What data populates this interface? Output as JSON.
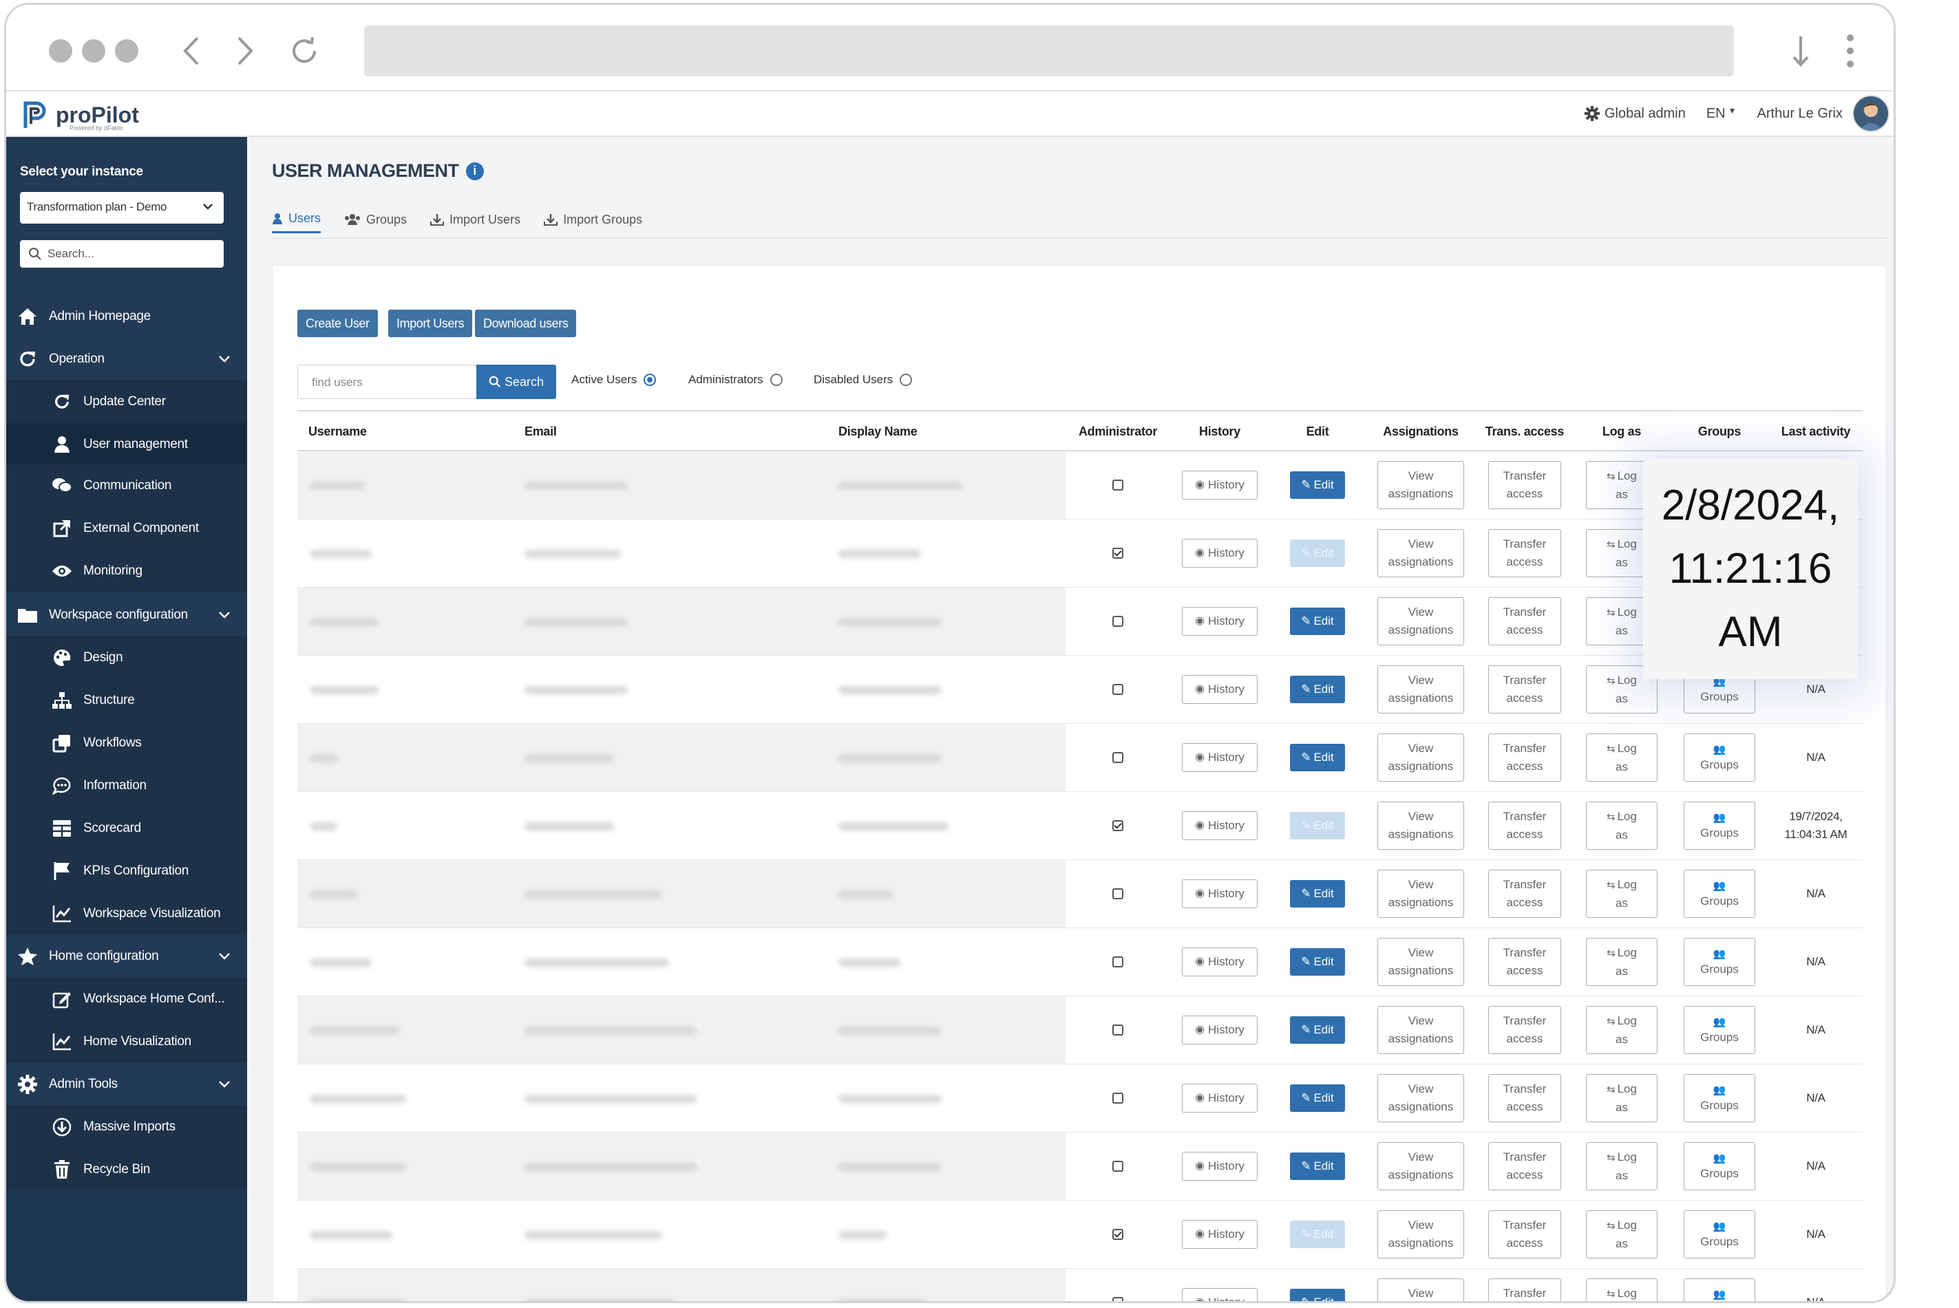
{
  "header": {
    "logo_text": "proPilot",
    "logo_sub": "Powered by dFakto",
    "role": "Global admin",
    "language": "EN",
    "user_name": "Arthur Le Grix"
  },
  "sidebar": {
    "instance_label": "Select your instance",
    "instance_value": "Transformation plan - Demo",
    "search_placeholder": "Search...",
    "items": [
      {
        "label": "Admin Homepage"
      },
      {
        "label": "Operation"
      },
      {
        "label": "Update Center"
      },
      {
        "label": "User management"
      },
      {
        "label": "Communication"
      },
      {
        "label": "External Component"
      },
      {
        "label": "Monitoring"
      },
      {
        "label": "Workspace configuration"
      },
      {
        "label": "Design"
      },
      {
        "label": "Structure"
      },
      {
        "label": "Workflows"
      },
      {
        "label": "Information"
      },
      {
        "label": "Scorecard"
      },
      {
        "label": "KPIs Configuration"
      },
      {
        "label": "Workspace Visualization"
      },
      {
        "label": "Home configuration"
      },
      {
        "label": "Workspace Home Conf..."
      },
      {
        "label": "Home Visualization"
      },
      {
        "label": "Admin Tools"
      },
      {
        "label": "Massive Imports"
      },
      {
        "label": "Recycle Bin"
      }
    ]
  },
  "main": {
    "title": "USER MANAGEMENT",
    "tabs": [
      {
        "label": "Users"
      },
      {
        "label": "Groups"
      },
      {
        "label": "Import Users"
      },
      {
        "label": "Import Groups"
      }
    ],
    "buttons": {
      "create_user": "Create User",
      "import_users": "Import Users",
      "download_users": "Download users"
    },
    "search": {
      "placeholder": "find users",
      "button": "Search"
    },
    "filters": {
      "active": "Active Users",
      "admins": "Administrators",
      "disabled": "Disabled Users"
    },
    "columns": {
      "username": "Username",
      "email": "Email",
      "display_name": "Display Name",
      "administrator": "Administrator",
      "history": "History",
      "edit": "Edit",
      "assignations": "Assignations",
      "trans_access": "Trans. access",
      "log_as": "Log as",
      "groups": "Groups",
      "last_activity": "Last activity"
    },
    "row_buttons": {
      "history": "History",
      "edit": "Edit",
      "view1": "View",
      "view2": "assignations",
      "transfer1": "Transfer",
      "transfer2": "access",
      "log1": "Log",
      "log2": "as",
      "groups": "Groups"
    },
    "rows": [
      {
        "admin": false,
        "edit_enabled": true,
        "last1": "",
        "last2": ""
      },
      {
        "admin": true,
        "edit_enabled": false,
        "last1": "",
        "last2": ""
      },
      {
        "admin": false,
        "edit_enabled": true,
        "last1": "",
        "last2": ""
      },
      {
        "admin": false,
        "edit_enabled": true,
        "last1": "N/A",
        "last2": ""
      },
      {
        "admin": false,
        "edit_enabled": true,
        "last1": "N/A",
        "last2": ""
      },
      {
        "admin": true,
        "edit_enabled": false,
        "last1": "19/7/2024,",
        "last2": "11:04:31 AM"
      },
      {
        "admin": false,
        "edit_enabled": true,
        "last1": "N/A",
        "last2": ""
      },
      {
        "admin": false,
        "edit_enabled": true,
        "last1": "N/A",
        "last2": ""
      },
      {
        "admin": false,
        "edit_enabled": true,
        "last1": "N/A",
        "last2": ""
      },
      {
        "admin": false,
        "edit_enabled": true,
        "last1": "N/A",
        "last2": ""
      },
      {
        "admin": false,
        "edit_enabled": true,
        "last1": "N/A",
        "last2": ""
      },
      {
        "admin": true,
        "edit_enabled": false,
        "last1": "N/A",
        "last2": ""
      },
      {
        "admin": false,
        "edit_enabled": true,
        "last1": "N/A",
        "last2": ""
      }
    ]
  },
  "tooltip": {
    "line1": "2/8/2024,",
    "line2": "11:21:16",
    "line3": "AM"
  },
  "colors": {
    "sidebar": "#233a55",
    "primary": "#2f6fae",
    "accent_tab": "#2c6fb5"
  }
}
